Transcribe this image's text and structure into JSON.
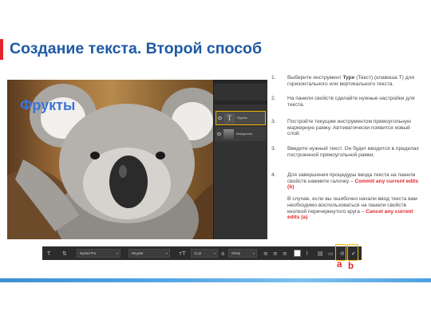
{
  "slide": {
    "title": "Создание текста. Второй способ",
    "accent_color": "#e4262c",
    "title_color": "#1f5aa5"
  },
  "photo": {
    "caption": "Фрукты",
    "layers": [
      {
        "thumb": "T",
        "name": "Фрукты",
        "type": "text",
        "selected": true
      },
      {
        "thumb": "",
        "name": "Background",
        "type": "image",
        "selected": false
      }
    ]
  },
  "steps": [
    {
      "num": "1.",
      "parts": [
        {
          "t": "Выберите инструмент "
        },
        {
          "t": "Type",
          "style": "b"
        },
        {
          "t": " (Текст) (клавиша T) для горизонтального или вертикального текста."
        }
      ]
    },
    {
      "num": "2.",
      "parts": [
        {
          "t": "На панели свойств сделайте нужные настройки для текста."
        }
      ]
    },
    {
      "num": "3.",
      "parts": [
        {
          "t": "Постройте текущим инструментом прямоугольную маркерную рамку. Автоматически появится новый слой."
        }
      ]
    },
    {
      "num": "3.",
      "parts": [
        {
          "t": "Введите нужный текст. Он будет вводится в пределах построенной прямоугольной рамки."
        }
      ]
    },
    {
      "num": "4.",
      "parts": [
        {
          "t": "Для завершения процедуры ввода текста на панели свойств нажмите галочку – "
        },
        {
          "t": "Commit any current edits (b)",
          "style": "red"
        },
        {
          "t": "  В случае, если вы ошибочно начали ввод текста вам необходимо воспользоваться на панели свойств кнопкой перечеркнутого круга – "
        },
        {
          "t": "Cancel any current edits",
          "style": "red"
        },
        {
          "t": " "
        },
        {
          "t": "(a)",
          "style": "red"
        }
      ]
    }
  ],
  "toolbar": {
    "tool_icon": "type-tool-icon",
    "font_family": "Myriad Pro",
    "font_style": "Regular",
    "font_size": "11 pt",
    "antialias": "Sharp",
    "cancel_label": "a",
    "commit_label": "b",
    "text_color": "#ffffff"
  }
}
